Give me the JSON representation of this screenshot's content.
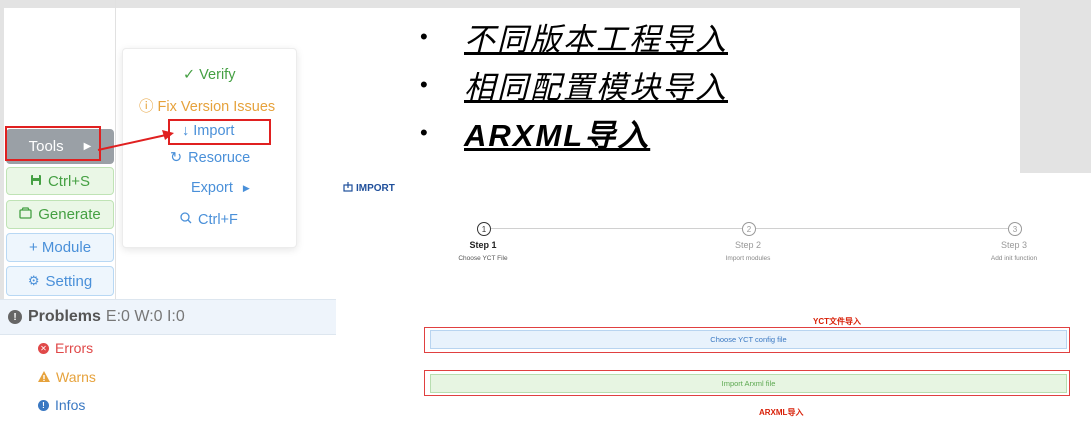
{
  "colors": {
    "red": "#e02020",
    "green": "#45a043",
    "blue": "#4a90d9",
    "orange": "#e6a23c",
    "navy": "#1f4f9b"
  },
  "toolbar": {
    "tools_label": "Tools",
    "ctrl_s_label": "Ctrl+S",
    "generate_label": "Generate",
    "module_label": "+ Module",
    "setting_label": "Setting"
  },
  "problems": {
    "title": "Problems",
    "counts": "E:0 W:0 I:0",
    "items": [
      {
        "label": "Errors",
        "icon": "error-icon"
      },
      {
        "label": "Warns",
        "icon": "warning-icon"
      },
      {
        "label": "Infos",
        "icon": "info-icon"
      }
    ]
  },
  "menu": {
    "verify": "✓ Verify",
    "fix": "ⓘ Fix Version Issues",
    "import": "↓ Import",
    "resource": "Resoruce",
    "export": "Export",
    "find": "Ctrl+F"
  },
  "bullets": [
    "不同版本工程导入",
    "相同配置模块导入",
    "ARXML导入"
  ],
  "import_page": {
    "title": "IMPORT",
    "steps": [
      {
        "num": "1",
        "title": "Step 1",
        "sub": "Choose YCT File"
      },
      {
        "num": "2",
        "title": "Step 2",
        "sub": "Import modules"
      },
      {
        "num": "3",
        "title": "Step 3",
        "sub": "Add init function"
      }
    ],
    "yct_label": "YCT文件导入",
    "choose_btn": "Choose YCT config file",
    "arxml_btn": "Import Arxml file",
    "arxml_label": "ARXML导入"
  }
}
